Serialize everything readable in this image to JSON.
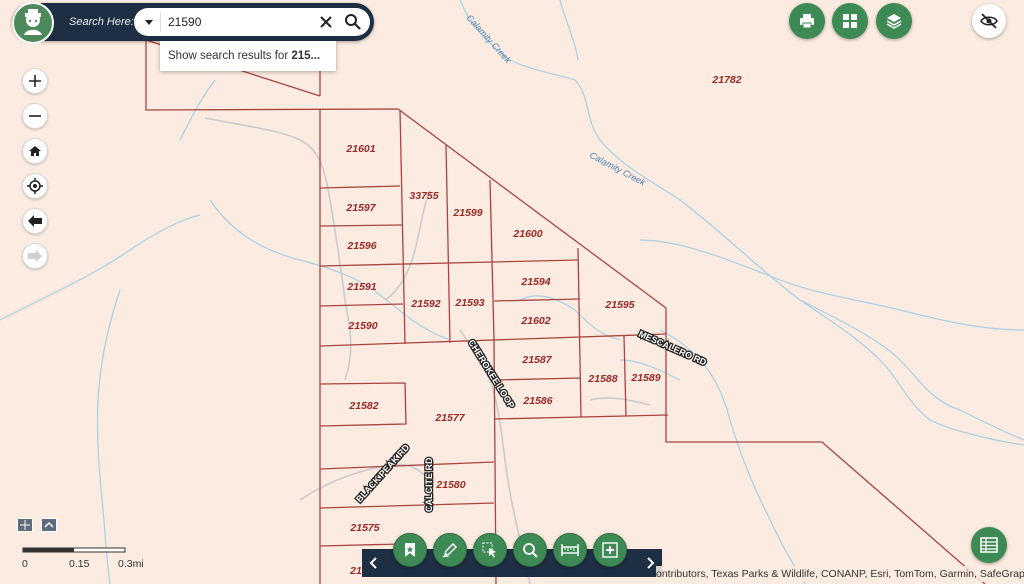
{
  "search": {
    "label": "Search Here:",
    "value": "21590",
    "suggestion_prefix": "Show search results for ",
    "suggestion_bold": "215..."
  },
  "map": {
    "parcels": [
      "21601",
      "33755",
      "21599",
      "21600",
      "21597",
      "21596",
      "21591",
      "21590",
      "21592",
      "21593",
      "21594",
      "21602",
      "21595",
      "21587",
      "21586",
      "21588",
      "21589",
      "21582",
      "21577",
      "21580",
      "21575",
      "21782"
    ],
    "creeks": [
      "Calamity Creek",
      "Calamity Creek"
    ],
    "roads": [
      "CHEROKEE LOOP",
      "MESCALERO RD",
      "BLACK PEAK RD",
      "CALCITE RD"
    ],
    "cut_label": "21"
  },
  "scale": {
    "ticks": [
      "0",
      "0.15",
      "0.3mi"
    ]
  },
  "attribution": "ontributors, Texas Parks & Wildlife, CONANP, Esri, TomTom, Garmin, SafeGrap..."
}
